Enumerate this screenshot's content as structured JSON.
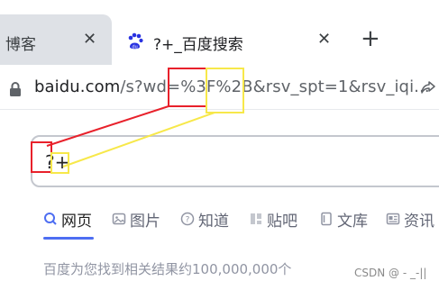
{
  "browser": {
    "tabs": [
      {
        "title": "博客",
        "close": "✕"
      },
      {
        "title": "?+_百度搜索",
        "close": "✕"
      }
    ],
    "new_tab": "+",
    "address": {
      "domain": "baidu.com",
      "path_before": "/s?wd=",
      "encoded_question": "%3F",
      "encoded_plus": "%2B",
      "path_after": "&rsv_spt=1&rsv_iqi..."
    }
  },
  "search": {
    "query_question": "?",
    "query_plus": "+"
  },
  "nav_tabs": [
    {
      "label": "网页",
      "icon": "search-icon"
    },
    {
      "label": "图片",
      "icon": "image-icon"
    },
    {
      "label": "知道",
      "icon": "question-icon"
    },
    {
      "label": "贴吧",
      "icon": "tieba-icon"
    },
    {
      "label": "文库",
      "icon": "document-icon"
    },
    {
      "label": "资讯",
      "icon": "news-icon"
    }
  ],
  "results": {
    "count_text": "百度为您找到相关结果约100,000,000个"
  },
  "watermark": "CSDN @ - _-||",
  "colors": {
    "annotation_red": "#e8212b",
    "annotation_yellow": "#f7e84a",
    "accent": "#4e6ef2"
  }
}
